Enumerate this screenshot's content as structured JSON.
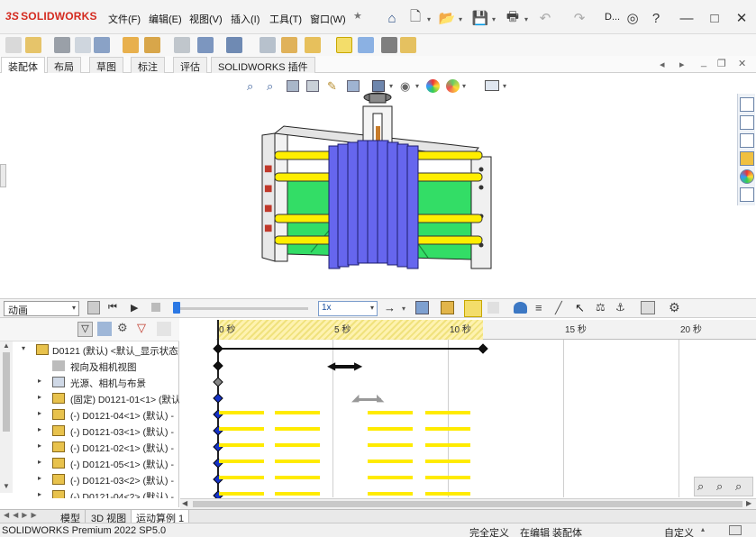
{
  "app": {
    "logo_text": "SOLIDWORKS",
    "doc_short": "D..."
  },
  "menu": [
    "文件(F)",
    "编辑(E)",
    "视图(V)",
    "插入(I)",
    "工具(T)",
    "窗口(W)"
  ],
  "tabs": [
    "装配体",
    "布局",
    "草图",
    "标注",
    "评估",
    "SOLIDWORKS 插件"
  ],
  "active_tab": "装配体",
  "motion": {
    "study_type": "动画",
    "speed": "1x",
    "ruler_labels": [
      "0 秒",
      "5 秒",
      "10 秒",
      "15 秒",
      "20 秒"
    ]
  },
  "tree": [
    {
      "label": "D0121 (默认) <默认_显示状态",
      "indent": 0,
      "expanded": true
    },
    {
      "label": "视向及相机视图",
      "indent": 1
    },
    {
      "label": "光源、相机与布景",
      "indent": 1
    },
    {
      "label": "(固定) D0121-01<1> (默认",
      "indent": 1
    },
    {
      "label": "(-) D0121-04<1> (默认) -",
      "indent": 1
    },
    {
      "label": "(-) D0121-03<1> (默认) -",
      "indent": 1
    },
    {
      "label": "(-) D0121-02<1> (默认) -",
      "indent": 1
    },
    {
      "label": "(-) D0121-05<1> (默认) -",
      "indent": 1
    },
    {
      "label": "(-) D0121-03<2> (默认) -",
      "indent": 1
    },
    {
      "label": "(-) D0121-04<2> (默认) -",
      "indent": 1
    }
  ],
  "bottom_tabs": [
    "模型",
    "3D 视图",
    "运动算例 1"
  ],
  "active_bottom_tab": "运动算例 1",
  "status": {
    "product": "SOLIDWORKS Premium 2022 SP5.0",
    "definition": "完全定义",
    "editing": "在编辑 装配体",
    "units": "自定义"
  },
  "colors": {
    "accent": "#1f5fbf",
    "brand_red": "#d42a1f",
    "plate_blue": "#6666ee",
    "base_green": "#33dd66",
    "rod_yellow": "#ffee00",
    "key_blue": "#1633c7"
  }
}
